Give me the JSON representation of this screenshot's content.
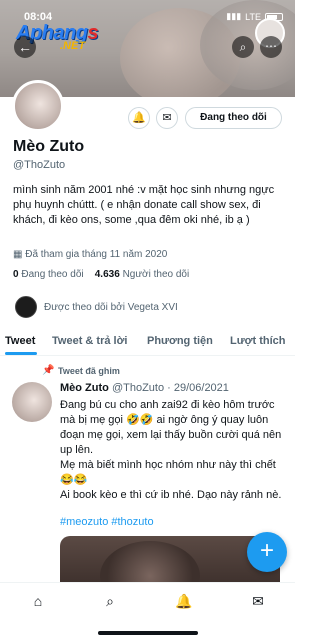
{
  "status_bar": {
    "time": "08:04",
    "network": "LTE"
  },
  "watermark": {
    "brand_main": "Aphang",
    "brand_accent": "s",
    "brand_suffix": ".NET"
  },
  "profile": {
    "name": "Mèo Zuto",
    "handle": "@ThoZuto",
    "follow_button": "Đang theo dõi",
    "bio": "mình sinh năm 2001 nhé :v mặt học sinh nhưng ngực phụ huynh chúttt. ( e nhận donate call show sex, đi khách, đi kèo ons, some ,qua đêm oki nhé, ib ạ )",
    "joined": "Đã tham gia tháng 11 năm 2020",
    "following_count": "0",
    "following_label": "Đang theo dõi",
    "followers_count": "4.636",
    "followers_label": "Người theo dõi",
    "followed_by": "Được theo dõi bởi Vegeta XVI"
  },
  "tabs": [
    {
      "label": "Tweet"
    },
    {
      "label": "Tweet & trả lời"
    },
    {
      "label": "Phương tiện"
    },
    {
      "label": "Lượt thích"
    }
  ],
  "pinned_tweet": {
    "pinned_label": "Tweet đã ghim",
    "author": "Mèo Zuto",
    "meta": "@ThoZuto · 29/06/2021",
    "lines": [
      "Đang bú cu cho anh zai92 đi kèo hôm trước mà bị mẹ gọi 🤣🤣 ai ngờ ông ý quay luôn đoạn mẹ gọi, xem lại thấy buồn cười quá nên up lên.",
      "Mẹ mà biết mình học nhóm như này thì chết 😂😂",
      "Ai book kèo e thì cứ ib nhé. Dạo này rảnh nè."
    ],
    "hashtags": "#meozuto #thozuto"
  },
  "colors": {
    "accent": "#1d9bf0",
    "text": "#0f1419",
    "muted": "#536471"
  },
  "icons": [
    "back-arrow-icon",
    "search-icon",
    "more-icon",
    "notification-bell-plus-icon",
    "mail-icon",
    "calendar-icon",
    "pin-icon",
    "compose-plus-icon",
    "home-icon",
    "explore-search-icon",
    "notifications-bell-icon",
    "messages-mail-icon"
  ]
}
